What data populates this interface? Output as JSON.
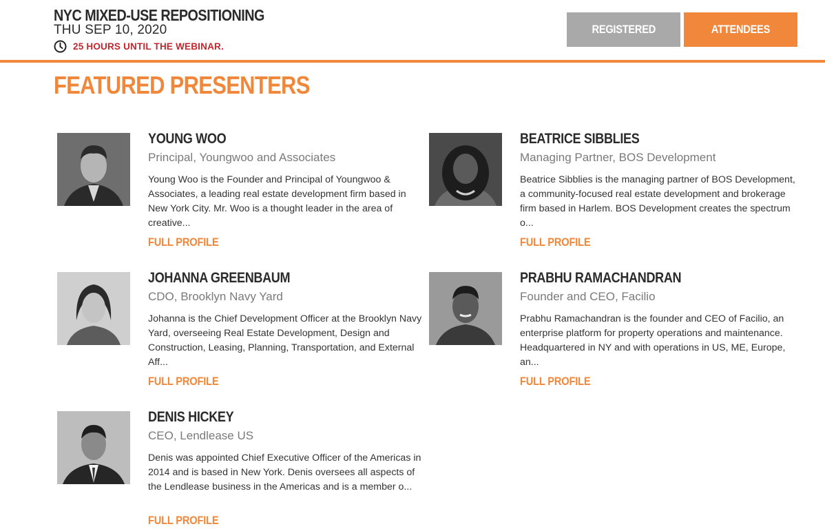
{
  "header": {
    "event_title": "NYC MIXED-USE REPOSITIONING",
    "event_date": "THU SEP 10, 2020",
    "countdown": "25 HOURS UNTIL THE WEBINAR.",
    "clock_icon": "clock-icon",
    "buttons": {
      "registered": "REGISTERED",
      "attendees": "ATTENDEES"
    }
  },
  "colors": {
    "accent": "#f0873a",
    "countdown_red": "#c2272d",
    "registered_gray": "#a9a9a9"
  },
  "section_title": "FEATURED PRESENTERS",
  "presenters": [
    {
      "name": "YOUNG WOO",
      "role": "Principal, Youngwoo and Associates",
      "bio": "Young Woo is the Founder and Principal of Youngwoo & Associates, a leading real estate development firm based in New York City. Mr. Woo is a thought leader in the area of creative...",
      "link": "FULL PROFILE"
    },
    {
      "name": "BEATRICE SIBBLIES",
      "role": "Managing Partner, BOS Development",
      "bio": "Beatrice Sibblies is the managing partner of BOS Development, a community-focused real estate development and brokerage firm based in Harlem. BOS Development creates the spectrum o...",
      "link": "FULL PROFILE"
    },
    {
      "name": "JOHANNA GREENBAUM",
      "role": "CDO, Brooklyn Navy Yard",
      "bio": "Johanna is the Chief Development Officer at the Brooklyn Navy Yard, overseeing Real Estate Development, Design and Construction, Leasing, Planning, Transportation, and External Aff...",
      "link": "FULL PROFILE"
    },
    {
      "name": "PRABHU RAMACHANDRAN",
      "role": "Founder and CEO, Facilio",
      "bio": "Prabhu Ramachandran is the founder and CEO of Facilio, an enterprise platform for property operations and maintenance. Headquartered in NY and with operations in US, ME, Europe, an...",
      "link": "FULL PROFILE"
    },
    {
      "name": "DENIS HICKEY",
      "role": "CEO, Lendlease US",
      "bio": "Denis was appointed Chief Executive Officer of the Americas in 2014 and is based in New York. Denis oversees all aspects of the Lendlease business in the Americas and is a member o...",
      "link": "FULL PROFILE"
    }
  ]
}
